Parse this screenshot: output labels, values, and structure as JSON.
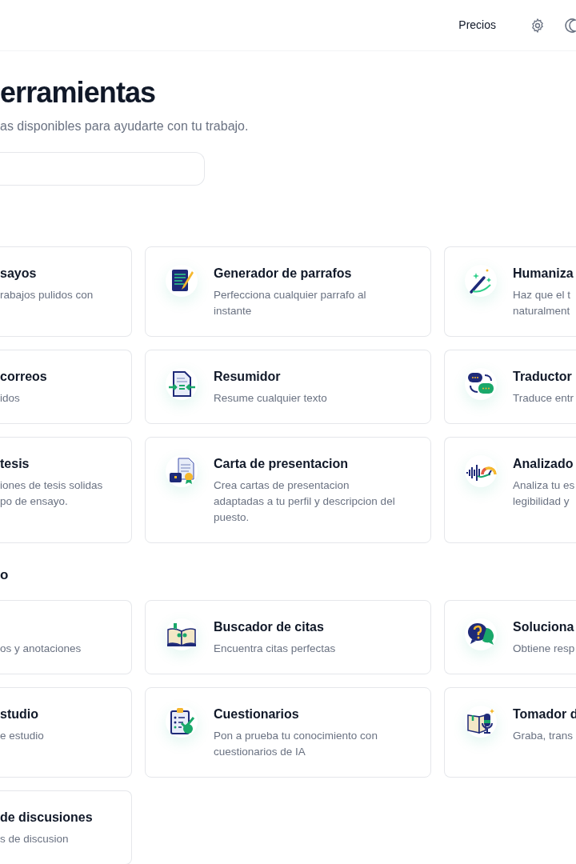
{
  "header": {
    "nav_link": "Precios"
  },
  "page": {
    "title": "erramientas",
    "subtitle": "as disponibles para ayudarte con tu trabajo."
  },
  "sections": [
    {
      "tools": [
        {
          "title": "sayos",
          "description": [
            "rabajos pulidos con"
          ]
        },
        {
          "kind": "notepad",
          "title": "Generador de parrafos",
          "description": [
            "Perfecciona cualquier parrafo al",
            "instante"
          ]
        },
        {
          "kind": "wand",
          "title": "Humaniza",
          "description": [
            "Haz que el t",
            "naturalment"
          ]
        },
        {
          "title": "correos",
          "description": [
            "idos"
          ]
        },
        {
          "kind": "summary",
          "title": "Resumidor",
          "description": [
            "Resume cualquier texto"
          ]
        },
        {
          "kind": "translate",
          "title": "Traductor",
          "description": [
            "Traduce entr"
          ]
        },
        {
          "title": "tesis",
          "description": [
            "iones de tesis solidas",
            "po de ensayo."
          ]
        },
        {
          "kind": "coverletter",
          "title": "Carta de presentacion",
          "description": [
            "Crea cartas de presentacion",
            "adaptadas a tu perfil y descripcion del",
            "puesto."
          ]
        },
        {
          "kind": "analyzer",
          "title": "Analizado",
          "description": [
            "Analiza tu es",
            "legibilidad y"
          ]
        }
      ]
    },
    {
      "heading": "o",
      "tools": [
        {
          "description": [
            "os y anotaciones"
          ]
        },
        {
          "kind": "quotes",
          "title": "Buscador de citas",
          "description": [
            "Encuentra citas perfectas"
          ]
        },
        {
          "kind": "solver",
          "title": "Soluciona",
          "description": [
            "Obtiene resp"
          ]
        },
        {
          "title": "studio",
          "description": [
            "e estudio"
          ]
        },
        {
          "kind": "quiz",
          "title": "Cuestionarios",
          "description": [
            "Pon a prueba tu conocimiento con",
            "cuestionarios de IA"
          ]
        },
        {
          "kind": "notes",
          "title": "Tomador d",
          "description": [
            "Graba, trans"
          ]
        },
        {
          "title": "de discusiones",
          "description": [
            "s de discusion"
          ]
        }
      ]
    }
  ]
}
